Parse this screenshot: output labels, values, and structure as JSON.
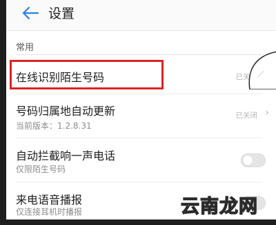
{
  "header": {
    "title": "设置"
  },
  "section": {
    "label": "常用"
  },
  "rows": [
    {
      "title": "在线识别陌生号码",
      "value": "已关闭"
    },
    {
      "title": "号码归属地自动更新",
      "subtitle": "当前版本：1.2.8.31",
      "value": "已关闭"
    },
    {
      "title": "自动拦截响一声电话",
      "subtitle": "仅限陌生号码",
      "toggle_on": false
    },
    {
      "title": "来电语音播报",
      "subtitle": "仅连接耳机时播报",
      "toggle_on": false
    }
  ],
  "highlight_color": "#e02020",
  "watermark": {
    "text": "云南龙网"
  },
  "icons": {
    "back": "arrow-left-icon",
    "chevron": "chevron-right-icon"
  }
}
